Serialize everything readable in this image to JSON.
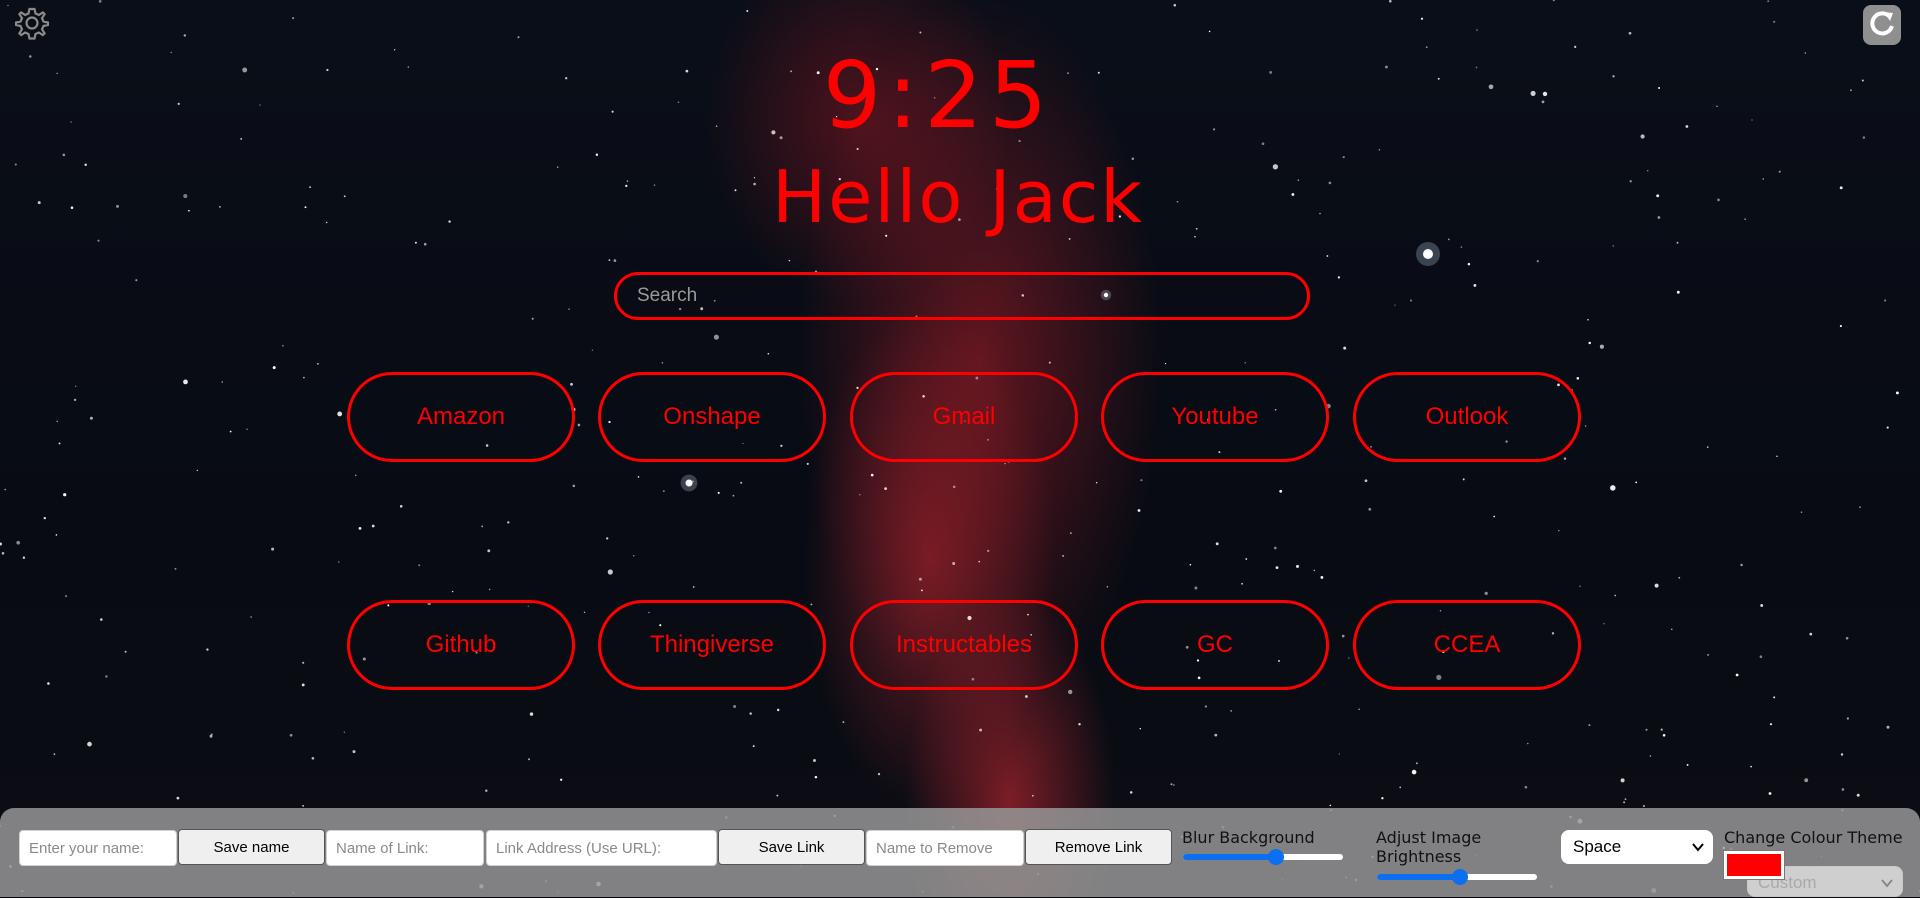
{
  "clock": {
    "time": "9:25",
    "greeting": "Hello Jack"
  },
  "search": {
    "placeholder": "Search"
  },
  "links": [
    [
      "Amazon",
      "Onshape",
      "Gmail",
      "Youtube",
      "Outlook"
    ],
    [
      "Github",
      "Thingiverse",
      "Instructables",
      "GC",
      "CCEA"
    ]
  ],
  "panel": {
    "name_placeholder": "Enter your name:",
    "save_name": "Save name",
    "link_name_placeholder": "Name of Link:",
    "link_address_placeholder": "Link Address (Use URL):",
    "save_link": "Save Link",
    "remove_placeholder": "Name to Remove",
    "remove_link": "Remove Link",
    "blur_label": "Blur Background",
    "blur_value": 0.58,
    "brightness_label_1": "Adjust Image",
    "brightness_label_2": "Brightness",
    "brightness_value": 0.52,
    "theme_selected": "Space",
    "colour_label": "Change Colour Theme",
    "colour_value": "#ff0000",
    "custom_selected": "Custom"
  },
  "colors": {
    "accent": "#ff0000",
    "slider": "#0b6ff0"
  },
  "icons": {
    "settings": "gear-icon",
    "refresh": "refresh-icon"
  }
}
